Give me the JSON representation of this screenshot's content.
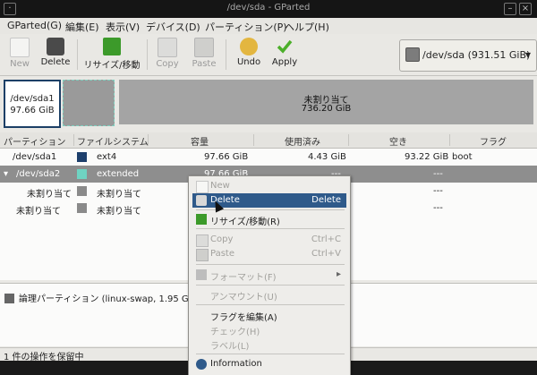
{
  "window": {
    "title": "/dev/sda - GParted"
  },
  "menubar": [
    "GParted(G)",
    "編集(E)",
    "表示(V)",
    "デバイス(D)",
    "パーティション(P)",
    "ヘルプ(H)"
  ],
  "toolbar": {
    "new": "New",
    "delete": "Delete",
    "resize": "リサイズ/移動",
    "copy": "Copy",
    "paste": "Paste",
    "undo": "Undo",
    "apply": "Apply"
  },
  "device_selector": {
    "value": "/dev/sda  (931.51 GiB)"
  },
  "graph": {
    "p1_name": "/dev/sda1",
    "p1_size": "97.66 GiB",
    "unalloc_label": "未割り当て",
    "unalloc_size": "736.20 GiB"
  },
  "table": {
    "headers": [
      "パーティション",
      "ファイルシステム",
      "容量",
      "使用済み",
      "空き",
      "フラグ"
    ],
    "rows": [
      {
        "partition": "/dev/sda1",
        "fs": "ext4",
        "size": "97.66 GiB",
        "used": "4.43 GiB",
        "free": "93.22 GiB",
        "flags": "boot",
        "color": "#1d3f6c"
      },
      {
        "partition": "/dev/sda2",
        "fs": "extended",
        "size": "97.66 GiB",
        "used": "---",
        "free": "---",
        "flags": "",
        "color": "#6fd3c2"
      },
      {
        "partition": "未割り当て",
        "fs": "未割り当て",
        "size": "",
        "used": "",
        "free": "---",
        "flags": "",
        "color": "#8a8a8a"
      },
      {
        "partition": "未割り当て",
        "fs": "未割り当て",
        "size": "",
        "used": "",
        "free": "---",
        "flags": "",
        "color": "#8a8a8a"
      }
    ]
  },
  "pending": {
    "op": "論理パーティション (linux-swap, 1.95 GiB)"
  },
  "status": {
    "text": "1 件の操作を保留中"
  },
  "context_menu": {
    "new": "New",
    "delete": "Delete",
    "delete_accel": "Delete",
    "resize": "リサイズ/移動(R)",
    "copy": "Copy",
    "copy_accel": "Ctrl+C",
    "paste": "Paste",
    "paste_accel": "Ctrl+V",
    "format": "フォーマット(F)",
    "unmount": "アンマウント(U)",
    "edit_flags": "フラグを編集(A)",
    "check": "チェック(H)",
    "label": "ラベル(L)",
    "info": "Information"
  },
  "colors": {
    "selection": "#2f5a8a",
    "ext4": "#1d3f6c",
    "extended": "#6fd3c2",
    "unallocated": "#a4a4a4"
  }
}
